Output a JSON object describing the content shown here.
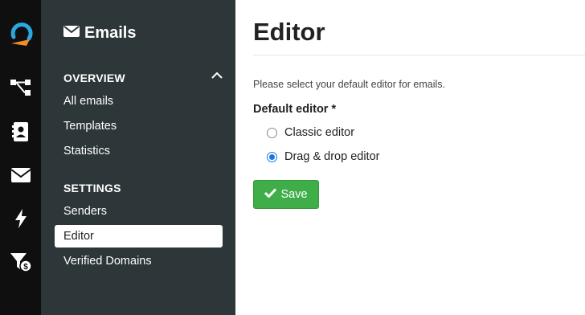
{
  "rail": {
    "icons": [
      "logo-icon",
      "workflow-icon",
      "contacts-icon",
      "email-icon",
      "automation-icon",
      "funnel-icon"
    ]
  },
  "sidebar": {
    "title": "Emails",
    "overview": {
      "heading": "OVERVIEW",
      "items": [
        {
          "label": "All emails"
        },
        {
          "label": "Templates"
        },
        {
          "label": "Statistics"
        }
      ]
    },
    "settings": {
      "heading": "SETTINGS",
      "items": [
        {
          "label": "Senders"
        },
        {
          "label": "Editor"
        },
        {
          "label": "Verified Domains"
        }
      ]
    }
  },
  "main": {
    "title": "Editor",
    "help": "Please select your default editor for emails.",
    "field_label": "Default editor *",
    "options": [
      {
        "label": "Classic editor",
        "checked": false
      },
      {
        "label": "Drag & drop editor",
        "checked": true
      }
    ],
    "save_label": "Save"
  },
  "colors": {
    "accent_blue": "#1a73e8",
    "save_green": "#3fae49",
    "sidebar_bg": "#2d3639",
    "rail_bg": "#0f0f10",
    "logo_blue": "#2aa8e0",
    "logo_orange": "#f28c28"
  }
}
